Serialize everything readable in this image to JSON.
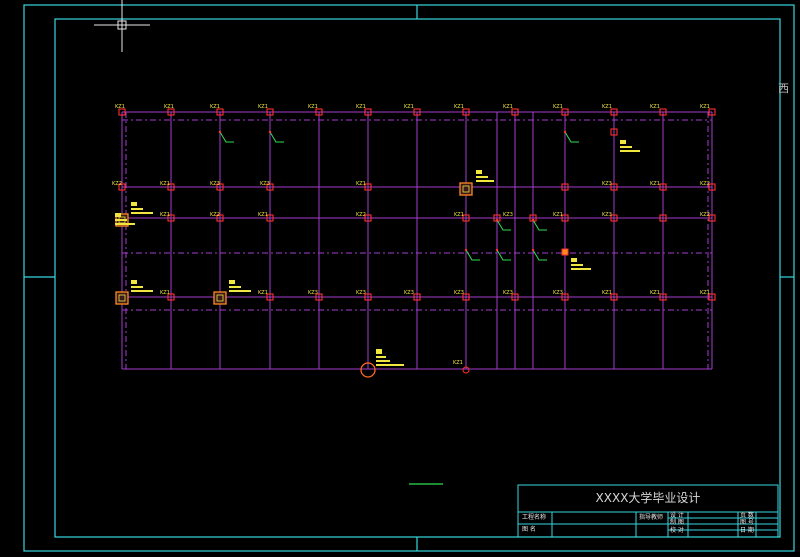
{
  "plan": {
    "grid_lines_x": [
      122,
      171,
      220,
      270,
      319,
      368,
      417,
      466,
      515,
      565,
      614,
      663,
      712
    ],
    "labels_row1": [
      "KZ1",
      "KZ1",
      "KZ1",
      "KZ1",
      "KZ1",
      "KZ1",
      "KZ1",
      "KZ1",
      "KZ1",
      "KZ1",
      "KZ1",
      "KZ1"
    ],
    "labels_row2": [
      "KZ2",
      "KZ1",
      "KZ3",
      "KZ3",
      "KZ1",
      "KZ3",
      "KZ1",
      "KZ2"
    ],
    "labels_row3": [
      "KZ1",
      "KZ2",
      "KZ1",
      "KZ2",
      "KZ1",
      "KZ3",
      "KZ1",
      "KZ3",
      "KZ2"
    ],
    "labels_row4": [
      "KZ1",
      "KZ1",
      "KZ3",
      "KZ3",
      "KZ3",
      "KZ3",
      "KZ3",
      "KZ3",
      "KZ1",
      "KZ1"
    ],
    "label_bottom": "KZ1",
    "colors": {
      "frame": "#36d8e0",
      "grid": "#a43cd0",
      "column": "#ff3030",
      "text": "#f0e640",
      "leader": "#30e050",
      "white": "#e0e0e0"
    }
  },
  "title_block": {
    "school": "XXXX大学毕业设计",
    "project_label": "工程名称",
    "drawing_label": "图 名",
    "advisor_label": "指导教师",
    "design_label": "设 计",
    "drafting_label": "制 图",
    "check_label": "校 对",
    "sheet_label": "页 数",
    "sheet_no_label": "图 号",
    "date_label": "日 期"
  },
  "side_char": "西"
}
